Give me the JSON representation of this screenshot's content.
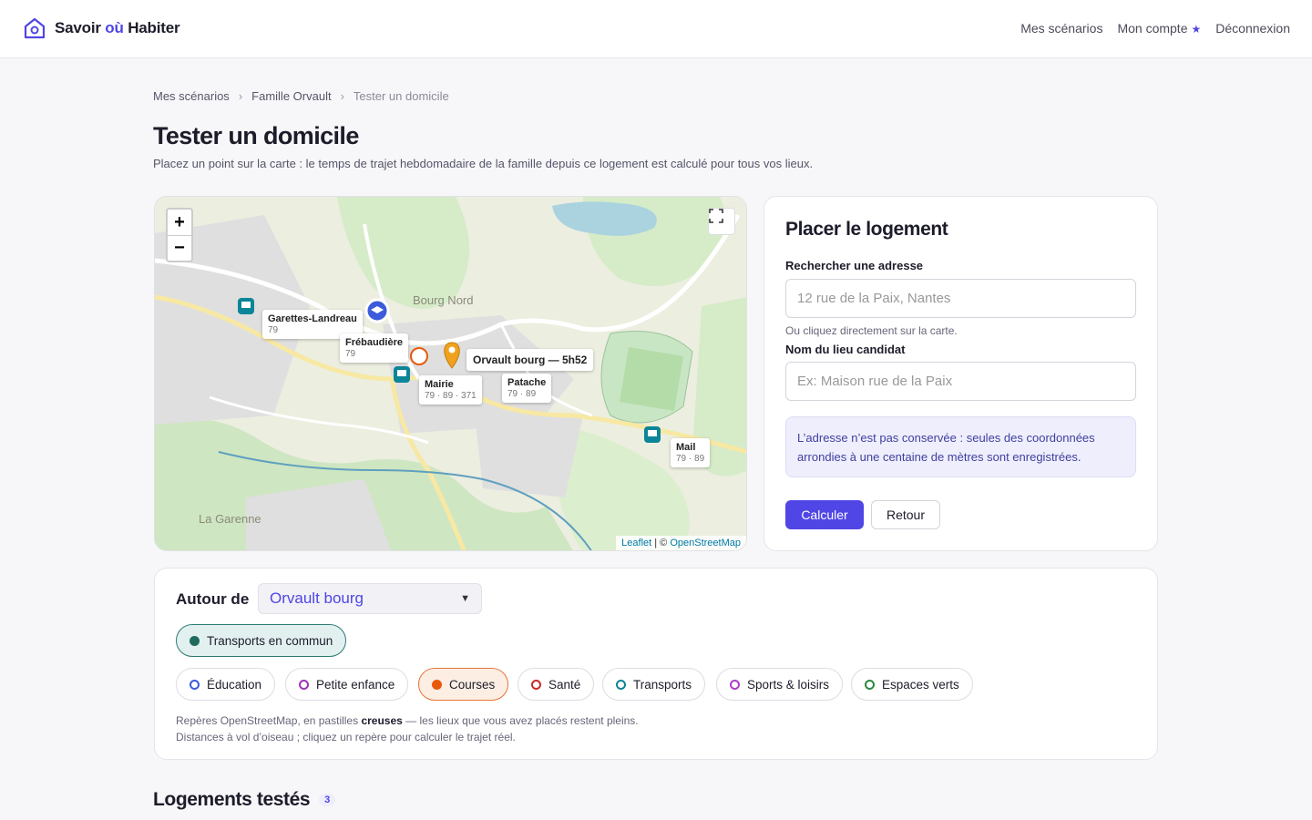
{
  "app": {
    "name_part1": "Savoir ",
    "name_part2": "où",
    "name_part3": " Habiter"
  },
  "nav": {
    "scenarios": "Mes scénarios",
    "account": "Mon compte",
    "account_star": "★",
    "logout": "Déconnexion"
  },
  "breadcrumb": {
    "items": [
      "Mes scénarios",
      "Famille Orvault",
      "Tester un domicile"
    ],
    "separator": "›"
  },
  "page": {
    "title": "Tester un domicile",
    "subtitle": "Placez un point sur la carte : le temps de trajet hebdomadaire de la famille depuis ce logement est calculé pour tous vos lieux."
  },
  "map": {
    "zoom_in": "+",
    "zoom_out": "−",
    "attribution_leaflet": "Leaflet",
    "attribution_sep": " | © ",
    "attribution_osm": "OpenStreetMap",
    "place_names": {
      "bourg_nord": "Bourg Nord",
      "garenne": "La Garenne"
    },
    "labels": [
      {
        "title": "Garettes-Landreau",
        "sub": "79"
      },
      {
        "title": "Frébaudière",
        "sub": "79"
      },
      {
        "title": "Orvault bourg — 5h52",
        "sub": ""
      },
      {
        "title": "Mairie",
        "sub": "79 · 89 · 371"
      },
      {
        "title": "Patache",
        "sub": "79 · 89"
      },
      {
        "title": "Mail",
        "sub": "79 · 89"
      }
    ]
  },
  "form": {
    "title": "Placer le logement",
    "search_label": "Rechercher une adresse",
    "search_placeholder": "12 rue de la Paix, Nantes",
    "hint": "Ou cliquez directement sur la carte.",
    "name_label": "Nom du lieu candidat",
    "name_placeholder": "Ex: Maison rue de la Paix",
    "notice": "L’adresse n’est pas conservée : seules des coordonnées arrondies à une centaine de mètres sont enregistrées.",
    "submit": "Calculer",
    "back": "Retour"
  },
  "around": {
    "label": "Autour de",
    "selected": "Orvault bourg",
    "transit_chip": "Transports en commun",
    "chips": [
      {
        "label": "Éducation",
        "color": "#3b5bdb",
        "filled": false
      },
      {
        "label": "Petite enfance",
        "color": "#9c36b5",
        "filled": false
      },
      {
        "label": "Courses",
        "color": "#e8590c",
        "filled": true
      },
      {
        "label": "Santé",
        "color": "#c92a2a",
        "filled": false
      },
      {
        "label": "Transports",
        "color": "#0c8599",
        "filled": false
      },
      {
        "label": "Sports & loisirs",
        "color": "#ae3ec9",
        "filled": false
      },
      {
        "label": "Espaces verts",
        "color": "#2b8a3e",
        "filled": false
      }
    ],
    "legend_line1_a": "Repères OpenStreetMap, en pastilles ",
    "legend_line1_b": "creuses",
    "legend_line1_c": " — les lieux que vous avez placés restent pleins.",
    "legend_line2": "Distances à vol d’oiseau ; cliquez un repère pour calculer le trajet réel."
  },
  "tested": {
    "title": "Logements testés",
    "count": "3"
  },
  "colors": {
    "accent": "#4f46e5",
    "transit": "#2d7a72",
    "courses": "#e5763c"
  }
}
